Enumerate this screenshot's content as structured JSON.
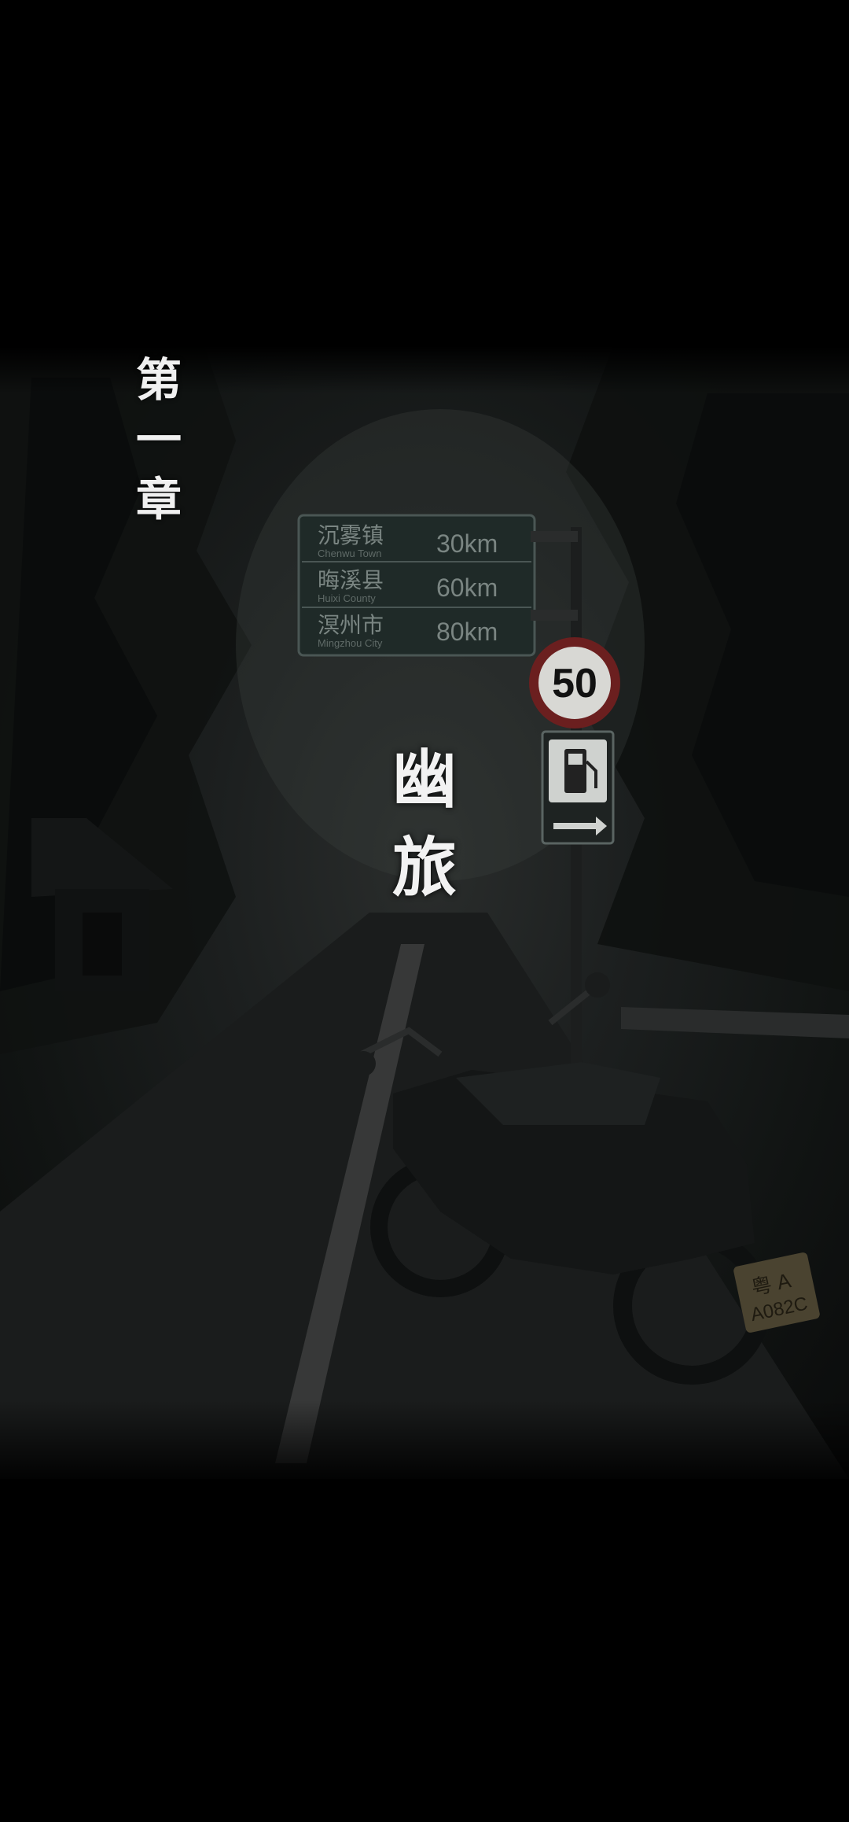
{
  "chapter": {
    "chars": [
      "第",
      "一",
      "章"
    ]
  },
  "title": {
    "chars": [
      "幽",
      "旅"
    ]
  },
  "road_sign": {
    "rows": [
      {
        "cn": "沉雾镇",
        "en": "Chenwu Town",
        "dist": "30km"
      },
      {
        "cn": "晦溪县",
        "en": "Huixi County",
        "dist": "60km"
      },
      {
        "cn": "溟州市",
        "en": "Mingzhou City",
        "dist": "80km"
      }
    ],
    "speed_limit": "50",
    "plate_top": "粤 A",
    "plate_bottom": "A082C"
  },
  "colors": {
    "background": "#000000",
    "text": "#f0f0f0",
    "sign_green": "#1f2a28",
    "speed_ring": "#6b1f1f"
  },
  "icons": [
    "fuel-pump-icon",
    "arrow-right-icon"
  ]
}
